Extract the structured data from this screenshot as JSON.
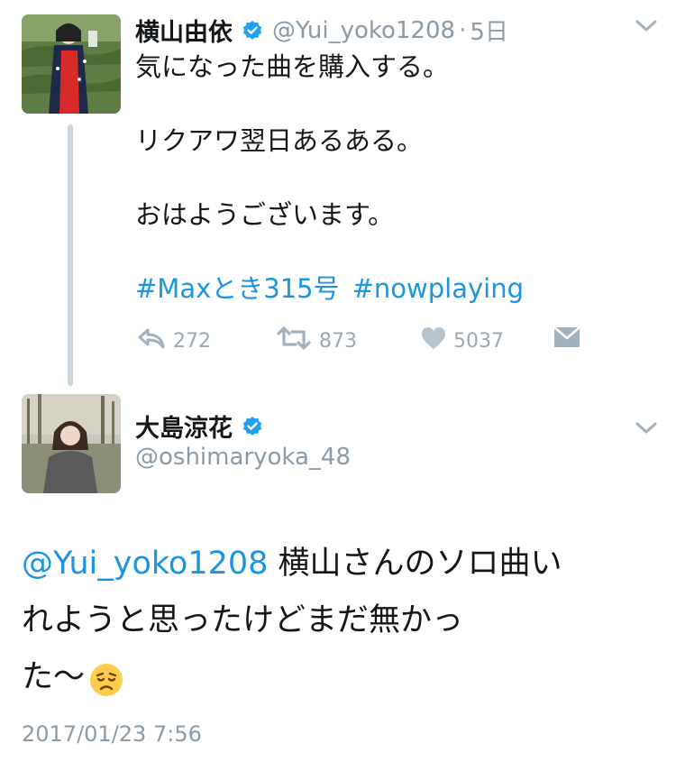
{
  "parent_tweet": {
    "name": "横山由依",
    "handle": "@Yui_yoko1208",
    "dot": "·",
    "time_ago": "5日",
    "lines": [
      "気になった曲を購入する。",
      "リクアワ翌日あるある。",
      "おはようございます。"
    ],
    "hashtags": [
      "#Maxとき315号",
      "#nowplaying"
    ],
    "actions": {
      "reply_count": "272",
      "retweet_count": "873",
      "like_count": "5037"
    }
  },
  "reply_tweet": {
    "name": "大島涼花",
    "handle": "@oshimaryoka_48",
    "mention": "@Yui_yoko1208",
    "text_line1": " 横山さんのソロ曲い",
    "text_line2": "れようと思ったけどまだ無かっ",
    "text_line3": "た〜",
    "emoji": "😞",
    "timestamp": "2017/01/23 7:56"
  },
  "colors": {
    "link": "#1b95e0",
    "verified": "#1da1f2",
    "muted": "#8a9aa7",
    "thread_line": "#ccd6dd"
  },
  "icons": [
    "verified-badge-icon",
    "chevron-down-icon",
    "reply-icon",
    "retweet-icon",
    "heart-icon",
    "direct-message-icon"
  ]
}
